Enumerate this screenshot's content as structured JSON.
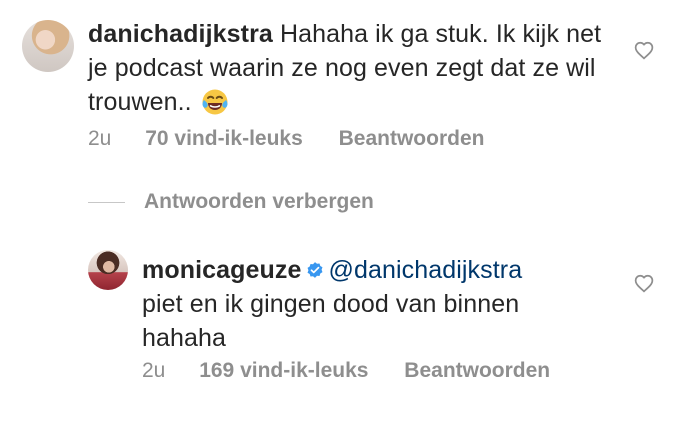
{
  "comments": [
    {
      "username": "danichadijkstra",
      "text": "Hahaha ik ga stuk. Ik kijk net je podcast waarin ze nog even zegt dat ze wil trouwen..",
      "emoji_icon": "face-with-tears-of-joy-icon",
      "time": "2u",
      "likes": "70 vind-ik-leuks",
      "reply_label": "Beantwoorden",
      "verified": false
    },
    {
      "username": "monicageuze",
      "verified": true,
      "mention": "@danichadijkstra",
      "text": "piet en ik gingen dood van binnen hahaha",
      "time": "2u",
      "likes": "169 vind-ik-leuks",
      "reply_label": "Beantwoorden"
    }
  ],
  "replies_toggle": {
    "label": "Antwoorden verbergen"
  },
  "colors": {
    "text": "#262626",
    "meta": "#8e8e8e",
    "mention": "#00376b",
    "verified": "#3897f0",
    "divider": "#c7c7c7"
  }
}
